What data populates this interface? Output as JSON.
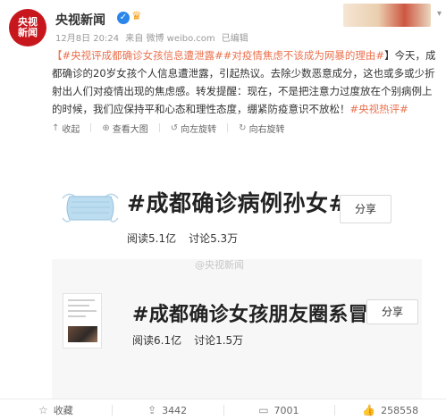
{
  "header": {
    "avatar_line1": "央视",
    "avatar_line2": "新闻",
    "user_name": "央视新闻",
    "date": "12月8日 20:24",
    "source": "来自 微博 weibo.com",
    "edited": "已编辑"
  },
  "post": {
    "topic_1": "【#央视评成都确诊女孩信息遭泄露#",
    "topic_2": "#对疫情焦虑不该成为网暴的理由#",
    "text_1": "】今天，成都确诊的20岁女孩个人信息遭泄露，引起热议。去除少数恶意成分，这也或多或少折射出人们对疫情出现的焦虑感。转发提醒：现在，不是把注意力过度放在个别病例上的时候，我们应保持平和心态和理性态度，绷紧防疫意识不放松！",
    "topic_3": "#央视热评#"
  },
  "toolbar": {
    "collapse": "收起",
    "view_large": "查看大图",
    "rotate_left": "向左旋转",
    "rotate_right": "向右旋转"
  },
  "image": {
    "card_1": {
      "title": "#成都确诊病例孙女#",
      "reads": "阅读5.1亿",
      "discussions": "讨论5.3万",
      "share": "分享"
    },
    "card_2": {
      "title": "#成都确诊女孩朋友圈系冒用#",
      "reads": "阅读6.1亿",
      "discussions": "讨论1.5万",
      "share": "分享"
    },
    "watermark": "@央视新闻"
  },
  "actions": {
    "favorite": "收藏",
    "repost_count": "3442",
    "comment_count": "7001",
    "like_count": "258558"
  },
  "colors": {
    "link": "#eb7350",
    "brand_red": "#c8161d",
    "verified_blue": "#2a86e8"
  },
  "icons": [
    "verified-icon",
    "crown-icon",
    "chevron-down-icon",
    "collapse-icon",
    "zoom-icon",
    "rotate-left-icon",
    "rotate-right-icon",
    "star-icon",
    "repost-icon",
    "comment-icon",
    "like-icon"
  ]
}
